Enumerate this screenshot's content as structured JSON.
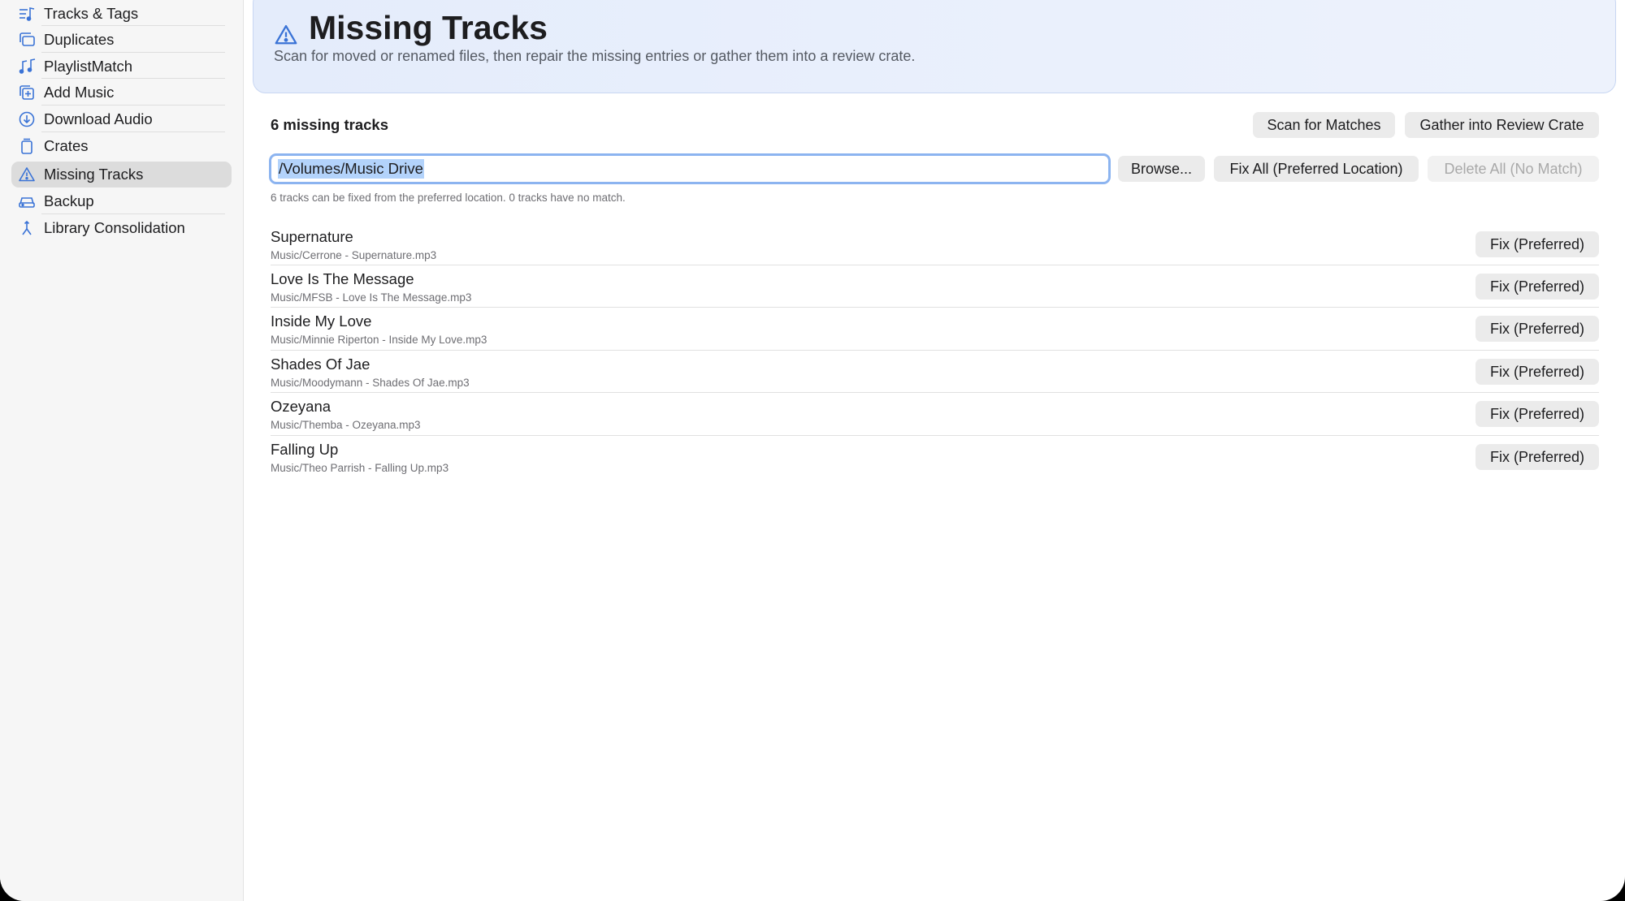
{
  "sidebar": {
    "items": [
      {
        "label": "Tracks & Tags",
        "icon": "tracks-tags-icon"
      },
      {
        "label": "Duplicates",
        "icon": "duplicates-icon"
      },
      {
        "label": "PlaylistMatch",
        "icon": "playlist-match-icon"
      },
      {
        "label": "Add Music",
        "icon": "add-music-icon"
      },
      {
        "label": "Download Audio",
        "icon": "download-icon"
      },
      {
        "label": "Crates",
        "icon": "crate-icon"
      },
      {
        "label": "Missing Tracks",
        "icon": "warning-icon",
        "active": true
      },
      {
        "label": "Backup",
        "icon": "backup-icon"
      },
      {
        "label": "Library Consolidation",
        "icon": "merge-icon"
      }
    ]
  },
  "header": {
    "title": "Missing Tracks",
    "subtitle": "Scan for moved or renamed files, then repair the missing entries or gather them into a review crate.",
    "icon": "warning-icon"
  },
  "toolbar": {
    "count_label": "6 missing tracks",
    "scan_label": "Scan for Matches",
    "gather_label": "Gather into Review Crate",
    "browse_label": "Browse...",
    "fix_all_label": "Fix All (Preferred Location)",
    "delete_all_label": "Delete All (No Match)"
  },
  "location": {
    "value": "/Volumes/Music Drive",
    "hint": "6 tracks can be fixed from the preferred location. 0 tracks have no match."
  },
  "tracks": [
    {
      "title": "Supernature",
      "path": "Music/Cerrone - Supernature.mp3",
      "action": "Fix (Preferred)"
    },
    {
      "title": "Love Is The Message",
      "path": "Music/MFSB - Love Is The Message.mp3",
      "action": "Fix (Preferred)"
    },
    {
      "title": "Inside My Love",
      "path": "Music/Minnie Riperton - Inside My Love.mp3",
      "action": "Fix (Preferred)"
    },
    {
      "title": "Shades Of Jae",
      "path": "Music/Moodymann - Shades Of Jae.mp3",
      "action": "Fix (Preferred)"
    },
    {
      "title": "Ozeyana",
      "path": "Music/Themba - Ozeyana.mp3",
      "action": "Fix (Preferred)"
    },
    {
      "title": "Falling Up",
      "path": "Music/Theo Parrish - Falling Up.mp3",
      "action": "Fix (Preferred)"
    }
  ],
  "colors": {
    "accent": "#3a73d6",
    "banner_bg": "#e4ecfb",
    "selection": "#b3d3fb"
  }
}
